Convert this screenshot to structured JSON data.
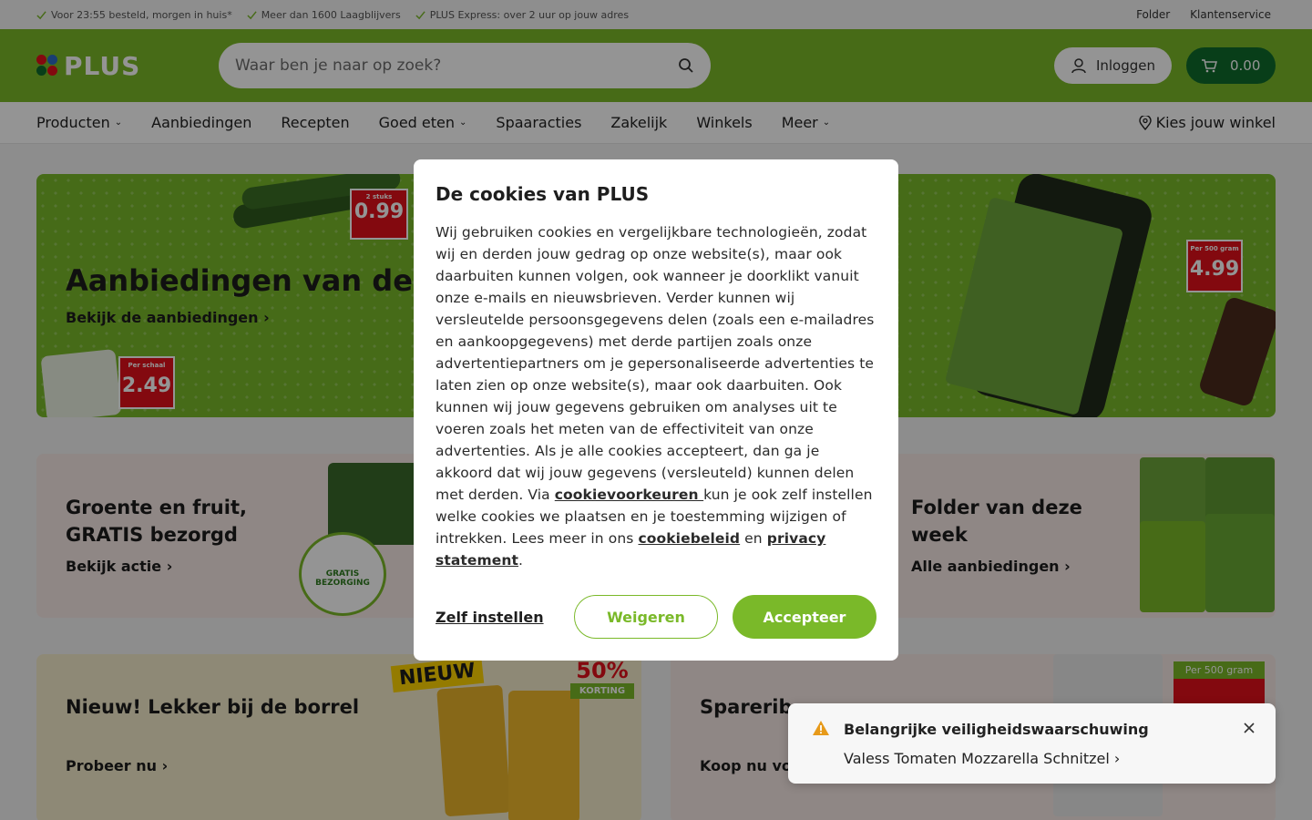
{
  "topbar": {
    "usps": [
      "Voor 23:55 besteld, morgen in huis*",
      "Meer dan 1600 Laagblijvers",
      "PLUS Express: over 2 uur op jouw adres"
    ],
    "links": [
      "Folder",
      "Klantenservice"
    ]
  },
  "header": {
    "logo_text": "PLUS",
    "search_placeholder": "Waar ben je naar op zoek?",
    "login_label": "Inloggen",
    "cart_total": "0.00"
  },
  "nav": {
    "items": [
      "Producten",
      "Aanbiedingen",
      "Recepten",
      "Goed eten",
      "Spaaracties",
      "Zakelijk",
      "Winkels",
      "Meer"
    ],
    "store_label": "Kies jouw winkel"
  },
  "hero": {
    "title": "Aanbiedingen van deze",
    "link": "Bekijk de aanbiedingen",
    "tag1": {
      "top": "2 stuks",
      "price": "0.99"
    },
    "tag2": {
      "top": "Per schaal",
      "price": "2.49"
    },
    "tag3": {
      "top": "Per 500 gram",
      "price": "4.99"
    }
  },
  "cards": {
    "groente": {
      "title_line1": "Groente en fruit,",
      "title_line2": "GRATIS bezorgd",
      "link": "Bekijk actie",
      "badge": "GRATIS BEZORGING"
    },
    "folder": {
      "title_line1": "Folder van deze",
      "title_line2": "week",
      "link": "Alle aanbiedingen"
    },
    "borrel": {
      "title": "Nieuw! Lekker bij de borrel",
      "link": "Probeer nu",
      "badge_new": "NIEUW",
      "badge_discount": "50%",
      "badge_discount_sub": "KORTING"
    },
    "spareribs": {
      "title": "Sparerib",
      "link": "Koop nu voo",
      "tag": "Per 500 gram"
    }
  },
  "cookie_modal": {
    "title": "De cookies van PLUS",
    "text_1": "Wij gebruiken cookies en vergelijkbare technologieën, zodat wij en derden jouw gedrag op onze website(s), maar ook daarbuiten kunnen volgen, ook wanneer je doorklikt vanuit onze e-mails en nieuwsbrieven. Verder kunnen wij versleutelde persoonsgegevens delen (zoals een e-mailadres en aankoopgegevens) met derde partijen zoals onze advertentiepartners om je gepersonaliseerde advertenties te laten zien op onze website(s), maar ook daarbuiten. Ook kunnen wij jouw gegevens gebruiken om analyses uit te voeren zoals het meten van de effectiviteit van onze advertenties. Als je alle cookies accepteert, dan ga je akkoord dat wij jouw gegevens (versleuteld) kunnen delen met derden. Via ",
    "link_preferences": "cookievoorkeuren ",
    "text_2": "kun je ook zelf instellen welke cookies we plaatsen en je toestemming wijzigen of intrekken. Lees meer in ons ",
    "link_policy": "cookiebeleid",
    "text_3": " en ",
    "link_privacy": "privacy statement",
    "text_4": ".",
    "btn_settings": "Zelf instellen",
    "btn_reject": "Weigeren",
    "btn_accept": "Accepteer"
  },
  "toast": {
    "title": "Belangrijke veiligheidswaarschuwing",
    "link": "Valess Tomaten Mozzarella Schnitzel"
  },
  "colors": {
    "brand_green": "#7ab929",
    "dark_green": "#0e6b2c",
    "price_red": "#e2101b"
  }
}
